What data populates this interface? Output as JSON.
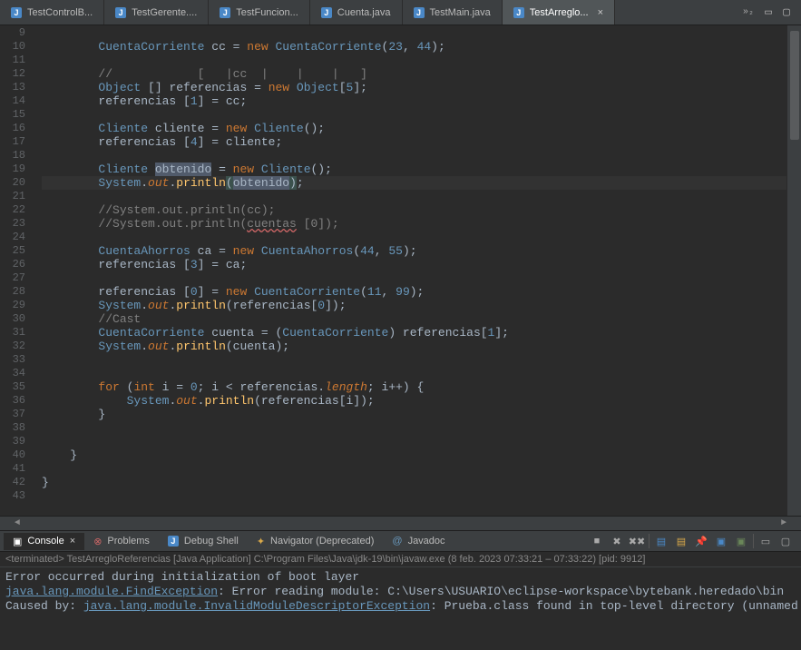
{
  "tabs": [
    {
      "label": "TestControlB...",
      "active": false
    },
    {
      "label": "TestGerente....",
      "active": false
    },
    {
      "label": "TestFuncion...",
      "active": false
    },
    {
      "label": "Cuenta.java",
      "active": false
    },
    {
      "label": "TestMain.java",
      "active": false
    },
    {
      "label": "TestArreglo...",
      "active": true
    }
  ],
  "overflow_label": "»₂",
  "gutter": {
    "start": 9,
    "end": 43
  },
  "code": {
    "l9": "",
    "l10_type": "CuentaCorriente",
    "l10_var": "cc",
    "l10_new": "new",
    "l10_ctor": "CuentaCorriente",
    "l10_a": "23",
    "l10_b": "44",
    "l11": "",
    "l12_cmt": "//            [   |cc  |    |    |   ]",
    "l13_type": "Object",
    "l13_var": "referencias",
    "l13_new": "new",
    "l13_ctor": "Object",
    "l13_sz": "5",
    "l14_var": "referencias",
    "l14_idx": "1",
    "l14_rhs": "cc",
    "l15": "",
    "l16_type": "Cliente",
    "l16_var": "cliente",
    "l16_new": "new",
    "l16_ctor": "Cliente",
    "l17_var": "referencias",
    "l17_idx": "4",
    "l17_rhs": "cliente",
    "l18": "",
    "l19_type": "Cliente",
    "l19_var": "obtenido",
    "l19_new": "new",
    "l19_ctor": "Cliente",
    "l20_sys": "System",
    "l20_out": "out",
    "l20_m": "println",
    "l20_arg": "obtenido",
    "l21": "",
    "l22_cmt": "//System.out.println(cc);",
    "l23_cmt_a": "//System.out.println(",
    "l23_cmt_b": "cuentas",
    "l23_cmt_c": " [0]);",
    "l24": "",
    "l25_type": "CuentaAhorros",
    "l25_var": "ca",
    "l25_new": "new",
    "l25_ctor": "CuentaAhorros",
    "l25_a": "44",
    "l25_b": "55",
    "l26_var": "referencias",
    "l26_idx": "3",
    "l26_rhs": "ca",
    "l27": "",
    "l28_var": "referencias",
    "l28_idx": "0",
    "l28_new": "new",
    "l28_ctor": "CuentaCorriente",
    "l28_a": "11",
    "l28_b": "99",
    "l29_sys": "System",
    "l29_out": "out",
    "l29_m": "println",
    "l29_arg": "referencias",
    "l29_idx": "0",
    "l30_cmt": "//Cast",
    "l31_type": "CuentaCorriente",
    "l31_var": "cuenta",
    "l31_cast": "CuentaCorriente",
    "l31_rhs": "referencias",
    "l31_idx": "1",
    "l32_sys": "System",
    "l32_out": "out",
    "l32_m": "println",
    "l32_arg": "cuenta",
    "l35_for": "for",
    "l35_int": "int",
    "l35_i": "i",
    "l35_z": "0",
    "l35_arr": "referencias",
    "l35_len": "length",
    "l36_sys": "System",
    "l36_out": "out",
    "l36_m": "println",
    "l36_arg": "referencias",
    "l36_i": "i",
    "l40_close": "}",
    "l42_close": "}"
  },
  "bottom_tabs": {
    "console": "Console",
    "problems": "Problems",
    "debug": "Debug Shell",
    "navigator": "Navigator (Deprecated)",
    "javadoc": "Javadoc"
  },
  "console": {
    "header": "<terminated> TestArregloReferencias [Java Application] C:\\Program Files\\Java\\jdk-19\\bin\\javaw.exe  (8 feb. 2023 07:33:21 – 07:33:22) [pid: 9912]",
    "line1": "Error occurred during initialization of boot layer",
    "line2_link": "java.lang.module.FindException",
    "line2_rest": ": Error reading module: C:\\Users\\USUARIO\\eclipse-workspace\\bytebank.heredado\\bin",
    "line3_pre": "Caused by: ",
    "line3_link": "java.lang.module.InvalidModuleDescriptorException",
    "line3_rest": ": Prueba.class found in top-level directory (unnamed package not"
  }
}
